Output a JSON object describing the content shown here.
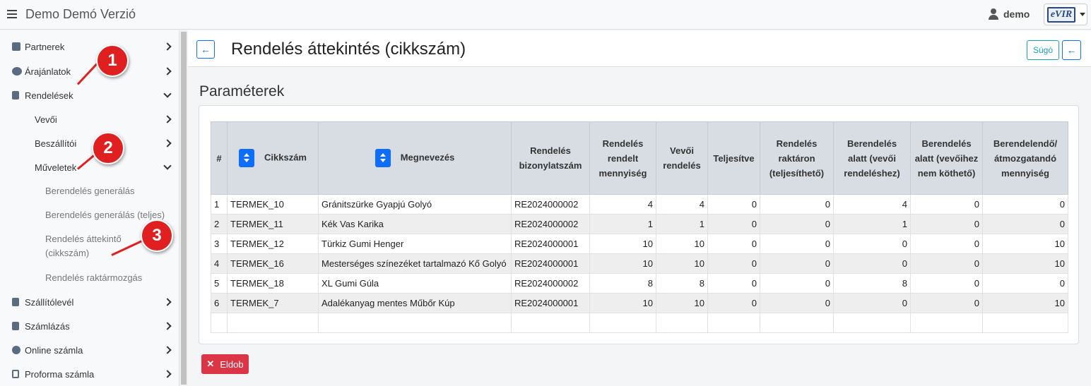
{
  "app": {
    "title": "Demo Demó Verzió",
    "user": "demo",
    "logo_text": "eVIR"
  },
  "sidebar": {
    "items": [
      {
        "label": "Partnerek",
        "icon": "contact-card-icon",
        "state": "collapsed"
      },
      {
        "label": "Árajánlatok",
        "icon": "comments-icon",
        "state": "collapsed"
      },
      {
        "label": "Rendelések",
        "icon": "document-icon",
        "state": "expanded"
      },
      {
        "label": "Vevői",
        "state": "collapsed"
      },
      {
        "label": "Beszállítói",
        "state": "collapsed"
      },
      {
        "label": "Műveletek",
        "state": "expanded"
      },
      {
        "label": "Berendelés generálás"
      },
      {
        "label": "Berendelés generálás (teljes)"
      },
      {
        "label": "Rendelés áttekintő (cikkszám)"
      },
      {
        "label": "Rendelés raktármozgás"
      },
      {
        "label": "Szállítólevél",
        "icon": "clipboard-icon",
        "state": "collapsed"
      },
      {
        "label": "Számlázás",
        "icon": "invoice-icon",
        "state": "collapsed"
      },
      {
        "label": "Online számla",
        "icon": "globe-icon",
        "state": "collapsed"
      },
      {
        "label": "Proforma számla",
        "icon": "file-icon",
        "state": "collapsed"
      }
    ],
    "markers": [
      "1",
      "2",
      "3"
    ],
    "marker_color": "#e02020"
  },
  "page": {
    "title": "Rendelés áttekintés (cikkszám)",
    "help_label": "Súgó",
    "section_title": "Paraméterek",
    "discard_label": "Eldob"
  },
  "table": {
    "headers": [
      "#",
      "Cikkszám",
      "Megnevezés",
      "Rendelés bizonylatszám",
      "Rendelés rendelt mennyiség",
      "Vevői rendelés",
      "Teljesítve",
      "Rendelés raktáron (teljesíthető)",
      "Berendelés alatt (vevői rendeléshez)",
      "Berendelés alatt (vevőihez nem köthető)",
      "Berendelendő/ átmozgatandó mennyiség"
    ],
    "rows": [
      [
        "1",
        "TERMEK_10",
        "Gránitszürke Gyapjú Golyó",
        "RE2024000002",
        "4",
        "4",
        "0",
        "0",
        "4",
        "0",
        "0"
      ],
      [
        "2",
        "TERMEK_11",
        "Kék Vas Karika",
        "RE2024000002",
        "1",
        "1",
        "0",
        "0",
        "1",
        "0",
        "0"
      ],
      [
        "3",
        "TERMEK_12",
        "Türkiz Gumi Henger",
        "RE2024000001",
        "10",
        "10",
        "0",
        "0",
        "0",
        "0",
        "10"
      ],
      [
        "4",
        "TERMEK_16",
        "Mesterséges színezéket tartalmazó Kő Golyó",
        "RE2024000001",
        "10",
        "10",
        "0",
        "0",
        "0",
        "0",
        "10"
      ],
      [
        "5",
        "TERMEK_18",
        "XL Gumi Gúla",
        "RE2024000002",
        "8",
        "8",
        "0",
        "0",
        "8",
        "0",
        "0"
      ],
      [
        "6",
        "TERMEK_7",
        "Adalékanyag mentes Műbőr Kúp",
        "RE2024000001",
        "10",
        "10",
        "0",
        "0",
        "0",
        "0",
        "10"
      ]
    ]
  },
  "colors": {
    "primary": "#0d6efd",
    "danger": "#dc3545",
    "info": "#17a2b8"
  }
}
